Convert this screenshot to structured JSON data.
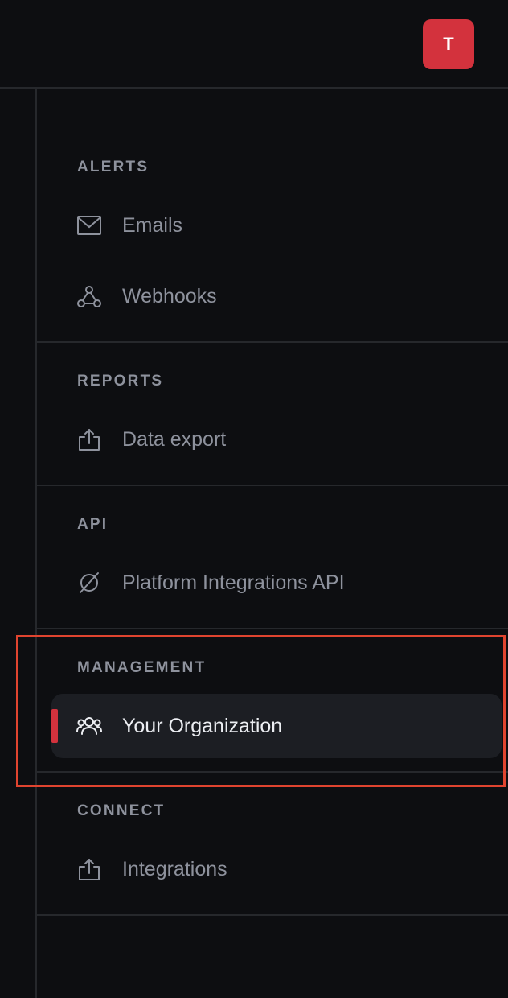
{
  "header": {
    "avatar_initial": "T"
  },
  "sections": {
    "alerts": {
      "title": "ALERTS",
      "items": [
        {
          "label": "Emails",
          "icon": "mail-icon"
        },
        {
          "label": "Webhooks",
          "icon": "webhook-icon"
        }
      ]
    },
    "reports": {
      "title": "REPORTS",
      "items": [
        {
          "label": "Data export",
          "icon": "export-icon"
        }
      ]
    },
    "api": {
      "title": "API",
      "items": [
        {
          "label": "Platform Integrations API",
          "icon": "empty-set-icon"
        }
      ]
    },
    "management": {
      "title": "MANAGEMENT",
      "items": [
        {
          "label": "Your Organization",
          "icon": "users-icon",
          "active": true
        }
      ]
    },
    "connect": {
      "title": "CONNECT",
      "items": [
        {
          "label": "Integrations",
          "icon": "export-icon"
        }
      ]
    }
  },
  "colors": {
    "background": "#0d0e11",
    "accent": "#d3323d",
    "highlight_outline": "#e0442f",
    "muted_text": "#8e929d",
    "active_text": "#eceef2"
  }
}
